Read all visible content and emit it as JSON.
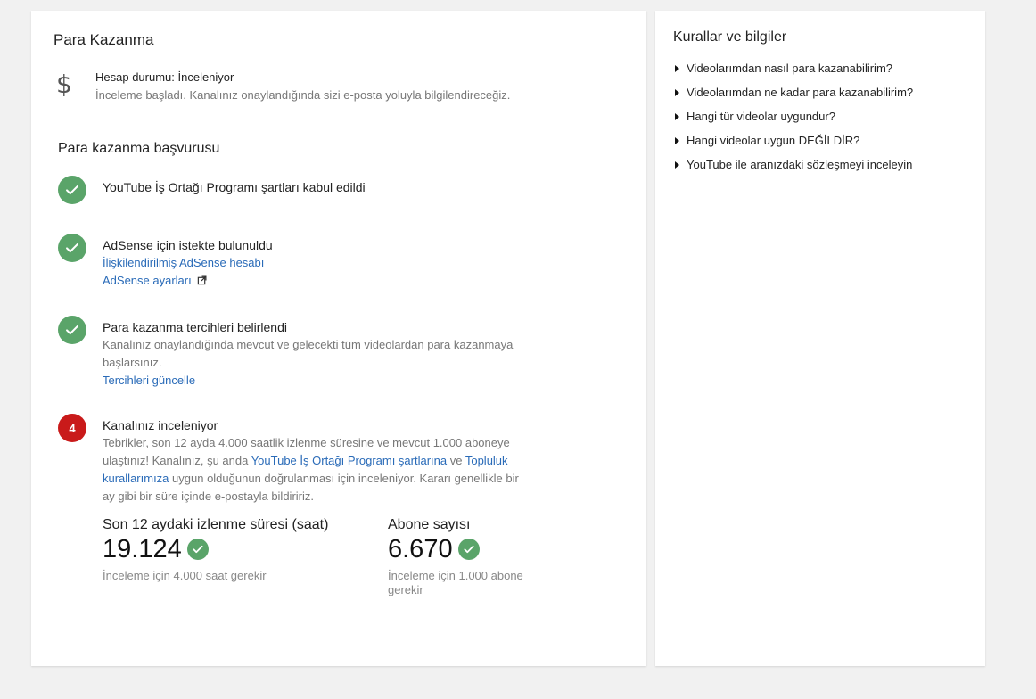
{
  "main": {
    "title": "Para Kazanma",
    "account": {
      "icon": "dollar-icon",
      "status": "Hesap durumu: İnceleniyor",
      "description": "İnceleme başladı. Kanalınız onaylandığında sizi e-posta yoluyla bilgilendireceğiz."
    },
    "application": {
      "title": "Para kazanma başvurusu",
      "steps": [
        {
          "state": "done",
          "title": "YouTube İş Ortağı Programı şartları kabul edildi"
        },
        {
          "state": "done",
          "title": "AdSense için istekte bulunuldu",
          "link1": "İlişkilendirilmiş AdSense hesabı",
          "link2": "AdSense ayarları"
        },
        {
          "state": "done",
          "title": "Para kazanma tercihleri belirlendi",
          "text": "Kanalınız onaylandığında mevcut ve gelecekti tüm videolardan para kazanmaya başlarsınız.",
          "link1": "Tercihleri güncelle"
        },
        {
          "state": "current",
          "number": "4",
          "title": "Kanalınız inceleniyor",
          "text_part1": "Tebrikler, son 12 ayda 4.000 saatlik izlenme süresine ve mevcut 1.000 aboneye ulaştınız! Kanalınız, şu anda ",
          "link_terms": "YouTube İş Ortağı Programı şartlarına",
          "text_part2": " ve ",
          "link_community": "Topluluk kurallarımıza",
          "text_part3": " uygun olduğunun doğrulanması için inceleniyor. Kararı genellikle bir ay gibi bir süre içinde e-postayla bildiririz."
        }
      ]
    },
    "metrics": [
      {
        "label": "Son 12 aydaki izlenme süresi (saat)",
        "value": "19.124",
        "note": "İnceleme için 4.000 saat gerekir"
      },
      {
        "label": "Abone sayısı",
        "value": "6.670",
        "note": "İnceleme için 1.000 abone gerekir"
      }
    ]
  },
  "side": {
    "title": "Kurallar ve bilgiler",
    "items": [
      "Videolarımdan nasıl para kazanabilirim?",
      "Videolarımdan ne kadar para kazanabilirim?",
      "Hangi tür videolar uygundur?",
      "Hangi videolar uygun DEĞİLDİR?",
      "YouTube ile aranızdaki sözleşmeyi inceleyin"
    ]
  },
  "colors": {
    "success": "#5aa469",
    "error": "#c91a1a",
    "link": "#2a6bb8"
  }
}
